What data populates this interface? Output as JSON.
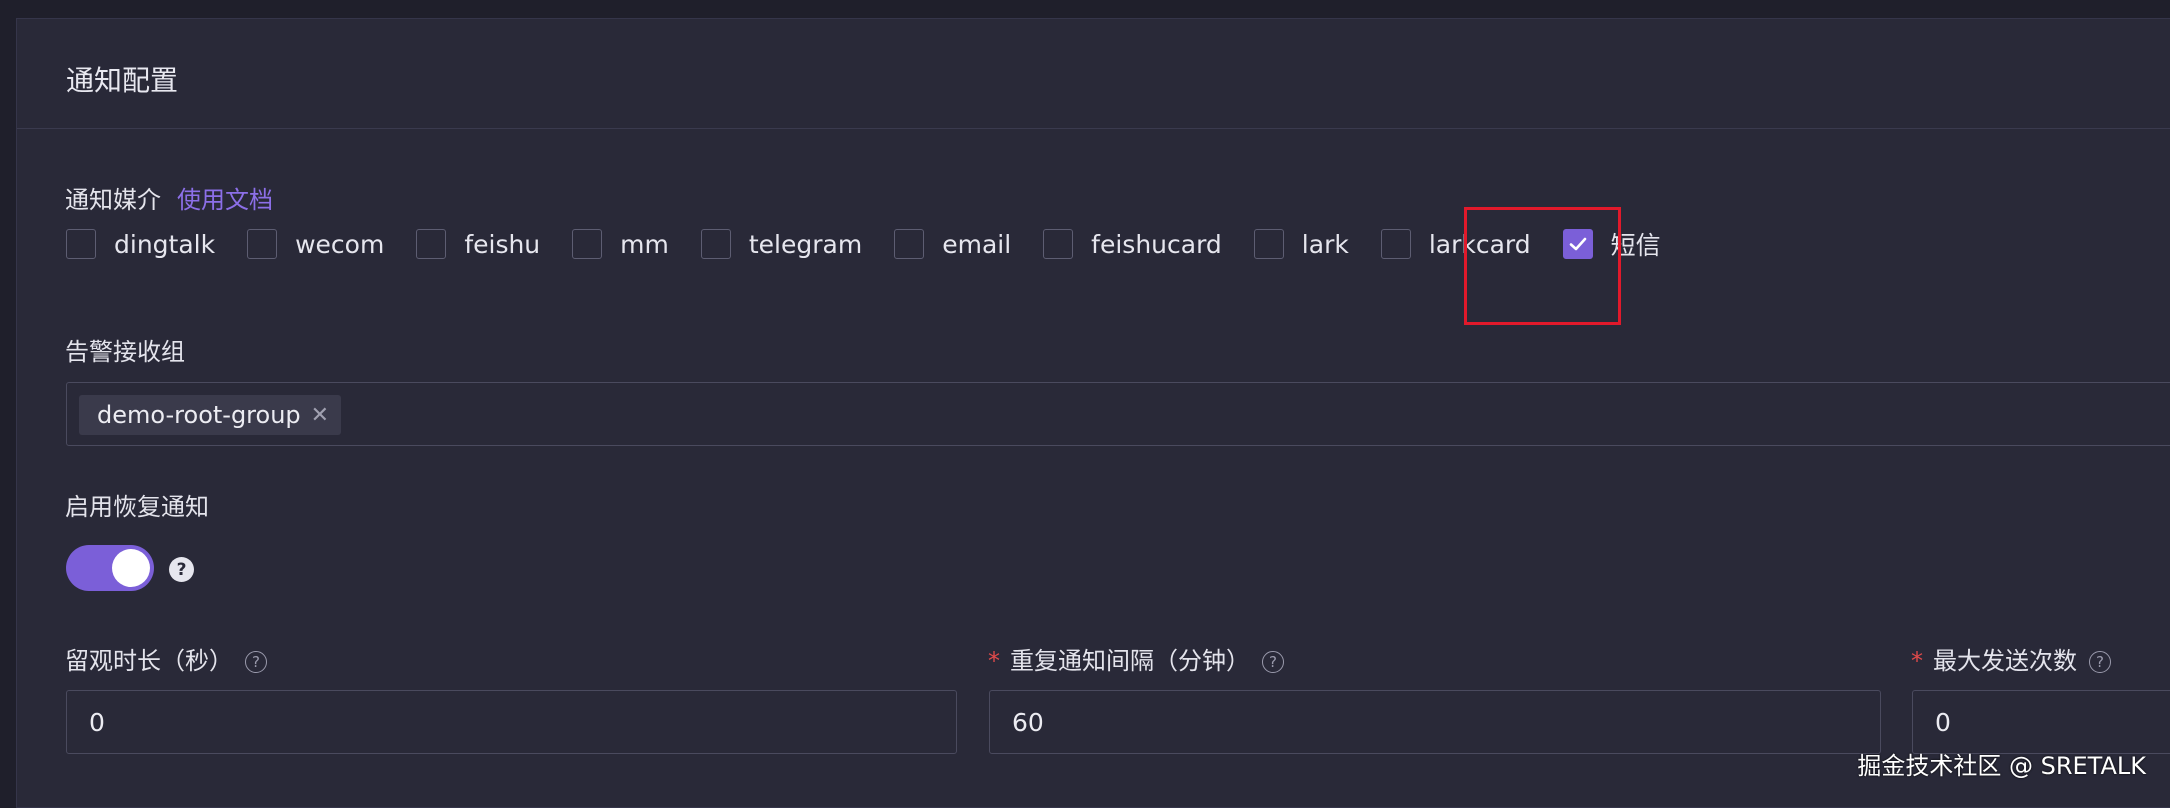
{
  "card": {
    "title": "通知配置"
  },
  "notify_channels": {
    "label": "通知媒介",
    "doc_link": "使用文档",
    "options": [
      {
        "label": "dingtalk",
        "checked": false
      },
      {
        "label": "wecom",
        "checked": false
      },
      {
        "label": "feishu",
        "checked": false
      },
      {
        "label": "mm",
        "checked": false
      },
      {
        "label": "telegram",
        "checked": false
      },
      {
        "label": "email",
        "checked": false
      },
      {
        "label": "feishucard",
        "checked": false
      },
      {
        "label": "lark",
        "checked": false
      },
      {
        "label": "larkcard",
        "checked": false
      },
      {
        "label": "短信",
        "checked": true
      }
    ]
  },
  "receiver_groups": {
    "label": "告警接收组",
    "selected": [
      "demo-root-group"
    ]
  },
  "recovery_notify": {
    "label": "启用恢复通知",
    "enabled": true
  },
  "fields": {
    "observe_duration": {
      "label": "留观时长（秒）",
      "value": "0",
      "required": false
    },
    "repeat_interval": {
      "label": "重复通知间隔（分钟）",
      "value": "60",
      "required": true
    },
    "max_send_times": {
      "label": "最大发送次数",
      "value": "0",
      "required": true
    }
  },
  "watermark": "掘金技术社区 @ SRETALK",
  "colors": {
    "accent": "#7b5fd8",
    "highlight": "#e1192b",
    "required": "#e04a4a"
  }
}
